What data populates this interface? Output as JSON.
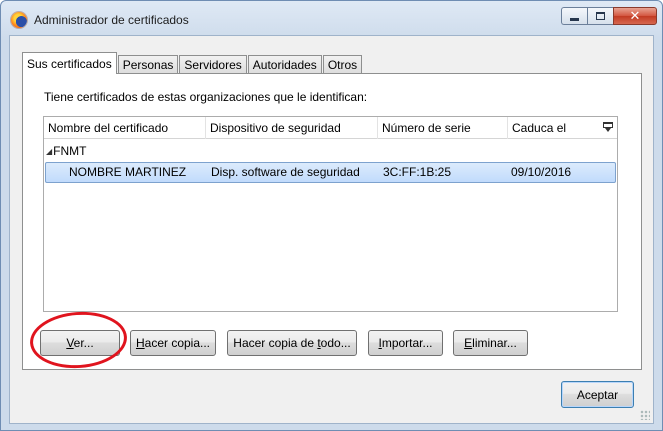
{
  "window": {
    "title": "Administrador de certificados",
    "icon": "firefox-icon",
    "controls": {
      "minimize": "minimize-icon",
      "maximize": "maximize-icon",
      "close": "✕"
    }
  },
  "tabs": [
    {
      "label": "Sus certificados",
      "active": true
    },
    {
      "label": "Personas",
      "active": false
    },
    {
      "label": "Servidores",
      "active": false
    },
    {
      "label": "Autoridades",
      "active": false
    },
    {
      "label": "Otros",
      "active": false
    }
  ],
  "panel": {
    "intro": "Tiene certificados de estas organizaciones que le identifican:",
    "columns": [
      "Nombre del certificado",
      "Dispositivo de seguridad",
      "Número de serie",
      "Caduca el"
    ],
    "column_picker_icon": "column-picker-icon",
    "groups": [
      {
        "name": "FNMT",
        "expanded": true,
        "rows": [
          {
            "name": "NOMBRE MARTINEZ",
            "device": "Disp. software de seguridad",
            "serial": "3C:FF:1B:25",
            "expires": "09/10/2016",
            "selected": true
          }
        ]
      }
    ],
    "buttons": {
      "view": {
        "label": "Ver...",
        "accesskey": "V"
      },
      "backup": {
        "label": "Hacer copia...",
        "accesskey": "H"
      },
      "backup_all": {
        "label": "Hacer copia de todo...",
        "accesskey": "t"
      },
      "import": {
        "label": "Importar...",
        "accesskey": "I"
      },
      "delete": {
        "label": "Eliminar...",
        "accesskey": "E"
      }
    }
  },
  "footer": {
    "ok": "Aceptar"
  },
  "annotation": {
    "color": "#e0141e",
    "target": "Ver..."
  }
}
